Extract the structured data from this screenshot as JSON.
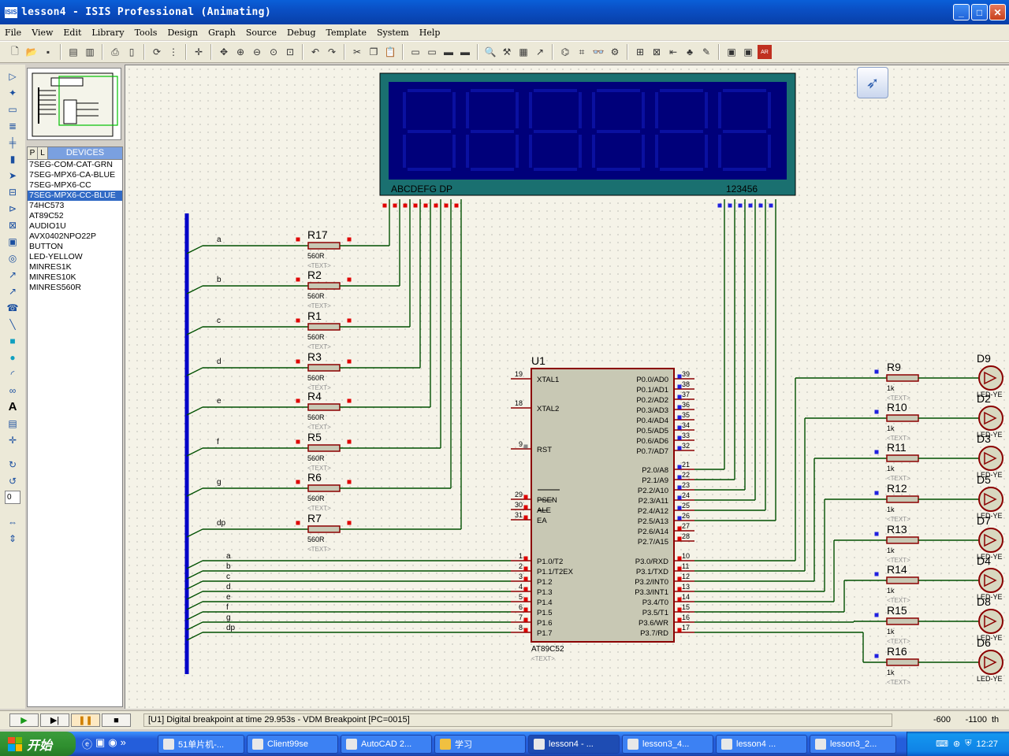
{
  "window": {
    "title": "lesson4 - ISIS Professional (Animating)",
    "app_icon": "ISIS",
    "minimize": "_",
    "maximize": "□",
    "close": "✕"
  },
  "menu": [
    "File",
    "View",
    "Edit",
    "Library",
    "Tools",
    "Design",
    "Graph",
    "Source",
    "Debug",
    "Template",
    "System",
    "Help"
  ],
  "devices": {
    "tab_p": "P",
    "tab_l": "L",
    "header": "DEVICES",
    "items": [
      "7SEG-COM-CAT-GRN",
      "7SEG-MPX6-CA-BLUE",
      "7SEG-MPX6-CC",
      "7SEG-MPX6-CC-BLUE",
      "74HC573",
      "AT89C52",
      "AUDIO1U",
      "AVX0402NPO22P",
      "BUTTON",
      "LED-YELLOW",
      "MINRES1K",
      "MINRES10K",
      "MINRES560R"
    ],
    "selected_index": 3
  },
  "rotation_value": "0",
  "schematic": {
    "display": {
      "segments_label": "ABCDEFG DP",
      "digits_label": "123456"
    },
    "bus_labels": [
      "a",
      "b",
      "c",
      "d",
      "e",
      "f",
      "g",
      "dp"
    ],
    "seg_resistors": [
      {
        "ref": "R17",
        "value": "560R",
        "text": "<TEXT>"
      },
      {
        "ref": "R2",
        "value": "560R",
        "text": "<TEXT>"
      },
      {
        "ref": "R1",
        "value": "560R",
        "text": "<TEXT>"
      },
      {
        "ref": "R3",
        "value": "560R",
        "text": "<TEXT>"
      },
      {
        "ref": "R4",
        "value": "560R",
        "text": "<TEXT>"
      },
      {
        "ref": "R5",
        "value": "560R",
        "text": "<TEXT>"
      },
      {
        "ref": "R6",
        "value": "560R",
        "text": "<TEXT>"
      },
      {
        "ref": "R7",
        "value": "560R",
        "text": "<TEXT>"
      }
    ],
    "mcu": {
      "ref": "U1",
      "part": "AT89C52",
      "text": "<TEXT>",
      "left_pins": [
        {
          "num": "19",
          "name": "XTAL1"
        },
        {
          "num": "18",
          "name": "XTAL2"
        },
        {
          "num": "9",
          "name": "RST"
        },
        {
          "num": "29",
          "name": "PSEN"
        },
        {
          "num": "30",
          "name": "ALE"
        },
        {
          "num": "31",
          "name": "EA"
        },
        {
          "num": "1",
          "name": "P1.0/T2"
        },
        {
          "num": "2",
          "name": "P1.1/T2EX"
        },
        {
          "num": "3",
          "name": "P1.2"
        },
        {
          "num": "4",
          "name": "P1.3"
        },
        {
          "num": "5",
          "name": "P1.4"
        },
        {
          "num": "6",
          "name": "P1.5"
        },
        {
          "num": "7",
          "name": "P1.6"
        },
        {
          "num": "8",
          "name": "P1.7"
        }
      ],
      "right_pins": [
        {
          "num": "39",
          "name": "P0.0/AD0"
        },
        {
          "num": "38",
          "name": "P0.1/AD1"
        },
        {
          "num": "37",
          "name": "P0.2/AD2"
        },
        {
          "num": "36",
          "name": "P0.3/AD3"
        },
        {
          "num": "35",
          "name": "P0.4/AD4"
        },
        {
          "num": "34",
          "name": "P0.5/AD5"
        },
        {
          "num": "33",
          "name": "P0.6/AD6"
        },
        {
          "num": "32",
          "name": "P0.7/AD7"
        },
        {
          "num": "21",
          "name": "P2.0/A8"
        },
        {
          "num": "22",
          "name": "P2.1/A9"
        },
        {
          "num": "23",
          "name": "P2.2/A10"
        },
        {
          "num": "24",
          "name": "P2.3/A11"
        },
        {
          "num": "25",
          "name": "P2.4/A12"
        },
        {
          "num": "26",
          "name": "P2.5/A13"
        },
        {
          "num": "27",
          "name": "P2.6/A14"
        },
        {
          "num": "28",
          "name": "P2.7/A15"
        },
        {
          "num": "10",
          "name": "P3.0/RXD"
        },
        {
          "num": "11",
          "name": "P3.1/TXD"
        },
        {
          "num": "12",
          "name": "P3.2/INT0"
        },
        {
          "num": "13",
          "name": "P3.3/INT1"
        },
        {
          "num": "14",
          "name": "P3.4/T0"
        },
        {
          "num": "15",
          "name": "P3.5/T1"
        },
        {
          "num": "16",
          "name": "P3.6/WR"
        },
        {
          "num": "17",
          "name": "P3.7/RD"
        }
      ]
    },
    "led_resistors": [
      {
        "ref": "R9",
        "value": "1k",
        "text": "<TEXT>"
      },
      {
        "ref": "R10",
        "value": "1k",
        "text": "<TEXT>"
      },
      {
        "ref": "R11",
        "value": "1k",
        "text": "<TEXT>"
      },
      {
        "ref": "R12",
        "value": "1k",
        "text": "<TEXT>"
      },
      {
        "ref": "R13",
        "value": "1k",
        "text": "<TEXT>"
      },
      {
        "ref": "R14",
        "value": "1k",
        "text": "<TEXT>"
      },
      {
        "ref": "R15",
        "value": "1k",
        "text": "<TEXT>"
      },
      {
        "ref": "R16",
        "value": "1k",
        "text": "<TEXT>"
      }
    ],
    "leds": [
      {
        "ref": "D9",
        "part": "LED-YE"
      },
      {
        "ref": "D2",
        "part": "LED-YE"
      },
      {
        "ref": "D3",
        "part": "LED-YE"
      },
      {
        "ref": "D5",
        "part": "LED-YE"
      },
      {
        "ref": "D7",
        "part": "LED-YE"
      },
      {
        "ref": "D4",
        "part": "LED-YE"
      },
      {
        "ref": "D8",
        "part": "LED-YE"
      },
      {
        "ref": "D6",
        "part": "LED-YE"
      }
    ],
    "colors": {
      "wire": "#005000",
      "bus": "#0000c8",
      "part_body": "#c8c8b4",
      "outline": "#8b0000",
      "display_bg": "#00007a",
      "display_frame": "#1a7070"
    }
  },
  "status": {
    "message": "[U1] Digital breakpoint at time 29.953s - VDM Breakpoint [PC=0015]",
    "x": "-600",
    "y": "-1100",
    "unit": "th"
  },
  "taskbar": {
    "start": "开始",
    "tasks": [
      "51单片机-...",
      "Client99se",
      "AutoCAD 2...",
      "学习",
      "lesson4 - ...",
      "lesson3_4...",
      "lesson4 ...",
      "lesson3_2..."
    ],
    "active_index": 4,
    "clock": "12:27"
  }
}
